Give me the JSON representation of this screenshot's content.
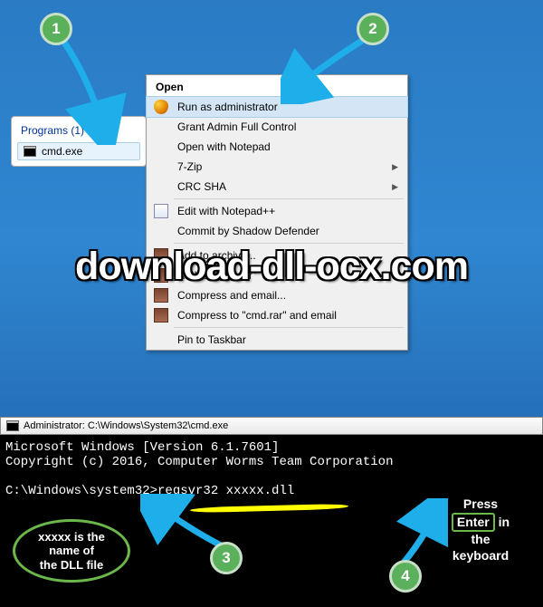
{
  "steps": {
    "s1": "1",
    "s2": "2",
    "s3": "3",
    "s4": "4"
  },
  "programs": {
    "header": "Programs (1)",
    "item": "cmd.exe"
  },
  "ctx": {
    "header": "Open",
    "run_admin": "Run as administrator",
    "grant_full": "Grant Admin Full Control",
    "open_notepad": "Open with Notepad",
    "sevenzip": "7-Zip",
    "crc": "CRC SHA",
    "edit_npp": "Edit with Notepad++",
    "commit_shadow": "Commit by Shadow Defender",
    "add_archive": "Add to archive...",
    "add_cmdrar": "Add to \"cmd.rar\"",
    "compress_email": "Compress and email...",
    "compress_rar_email": "Compress to \"cmd.rar\" and email",
    "pin_taskbar": "Pin to Taskbar"
  },
  "watermark_text": "download-dll-ocx.com",
  "cmd": {
    "title": "Administrator: C:\\Windows\\System32\\cmd.exe",
    "line1": "Microsoft Windows [Version 6.1.7601]",
    "line2": "Copyright (c) 2016, Computer Worms Team Corporation",
    "line3": "C:\\Windows\\system32>regsvr32 xxxxx.dll"
  },
  "hints": {
    "left_l1": "xxxxx is the",
    "left_l2": "name of",
    "left_l3": "the DLL file",
    "right_l1": "Press",
    "right_enter": "Enter",
    "right_l2": "in",
    "right_l3": "the",
    "right_l4": "keyboard"
  }
}
